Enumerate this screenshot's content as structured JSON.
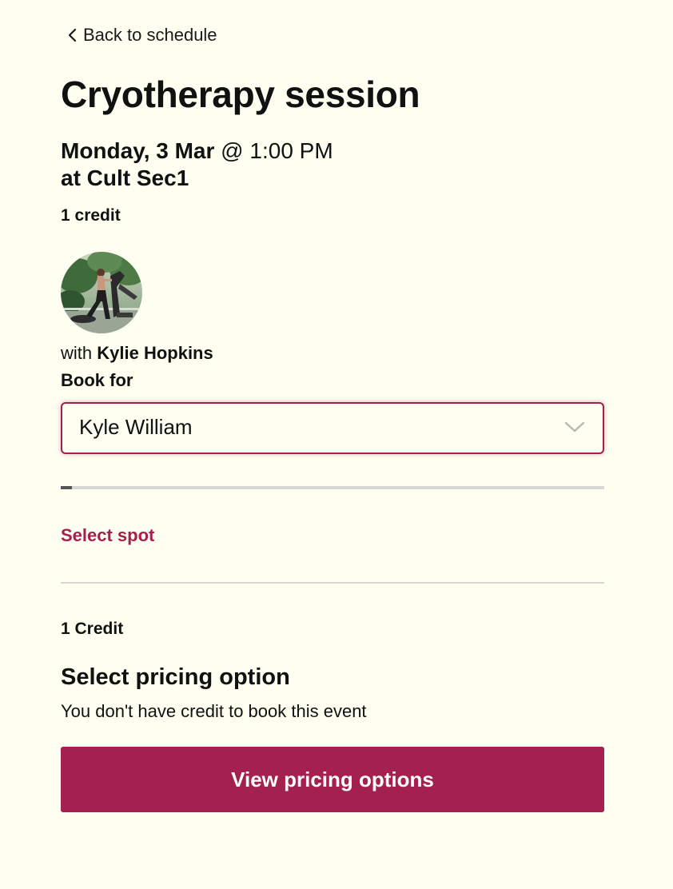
{
  "nav": {
    "back_label": "Back to schedule"
  },
  "event": {
    "title": "Cryotherapy session",
    "date": "Monday, 3 Mar",
    "time_prefix": " @ ",
    "time": "1:00 PM",
    "location": "at Cult Sec1",
    "credit_label": "1 credit"
  },
  "instructor": {
    "prefix": "with ",
    "name": "Kylie Hopkins"
  },
  "booking": {
    "book_for_label": "Book for",
    "selected_person": "Kyle William",
    "progress_fraction": 0.003
  },
  "spot": {
    "select_label": "Select spot"
  },
  "pricing": {
    "credit_label": "1 Credit",
    "heading": "Select pricing option",
    "note": "You don't have credit to book this event",
    "button_label": "View pricing options"
  },
  "colors": {
    "accent": "#a3204f",
    "background": "#fefff0"
  },
  "icons": {
    "back": "chevron-left-icon",
    "dropdown": "chevron-down-icon"
  }
}
